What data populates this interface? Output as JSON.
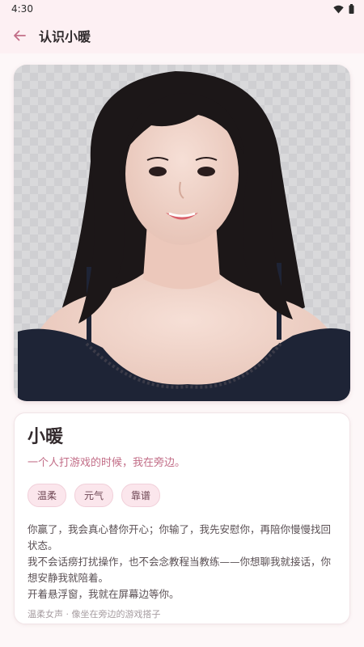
{
  "status_bar": {
    "time": "4:30",
    "wifi_icon": "wifi-icon",
    "battery_icon": "battery-icon"
  },
  "app_bar": {
    "back_icon": "arrow-left-icon",
    "title": "认识小暖"
  },
  "hero_image": {
    "alt": "小暖",
    "accent": "#e8b6c3"
  },
  "profile": {
    "name": "小暖",
    "tagline": "一个人打游戏的时候，我在旁边。",
    "tags": [
      "温柔",
      "元气",
      "靠谱"
    ],
    "description": [
      "你赢了，我会真心替你开心；你输了，我先安慰你，再陪你慢慢找回状态。",
      "我不会话痨打扰操作，也不会念教程当教练——你想聊我就接话，你想安静我就陪着。",
      "开着悬浮窗，我就在屏幕边等你。"
    ],
    "voice_note": "温柔女声 · 像坐在旁边的游戏搭子"
  },
  "colors": {
    "accent": "#c26d87",
    "bar_bg": "#fdf0f3",
    "tag_bg": "#fbe6ec"
  }
}
